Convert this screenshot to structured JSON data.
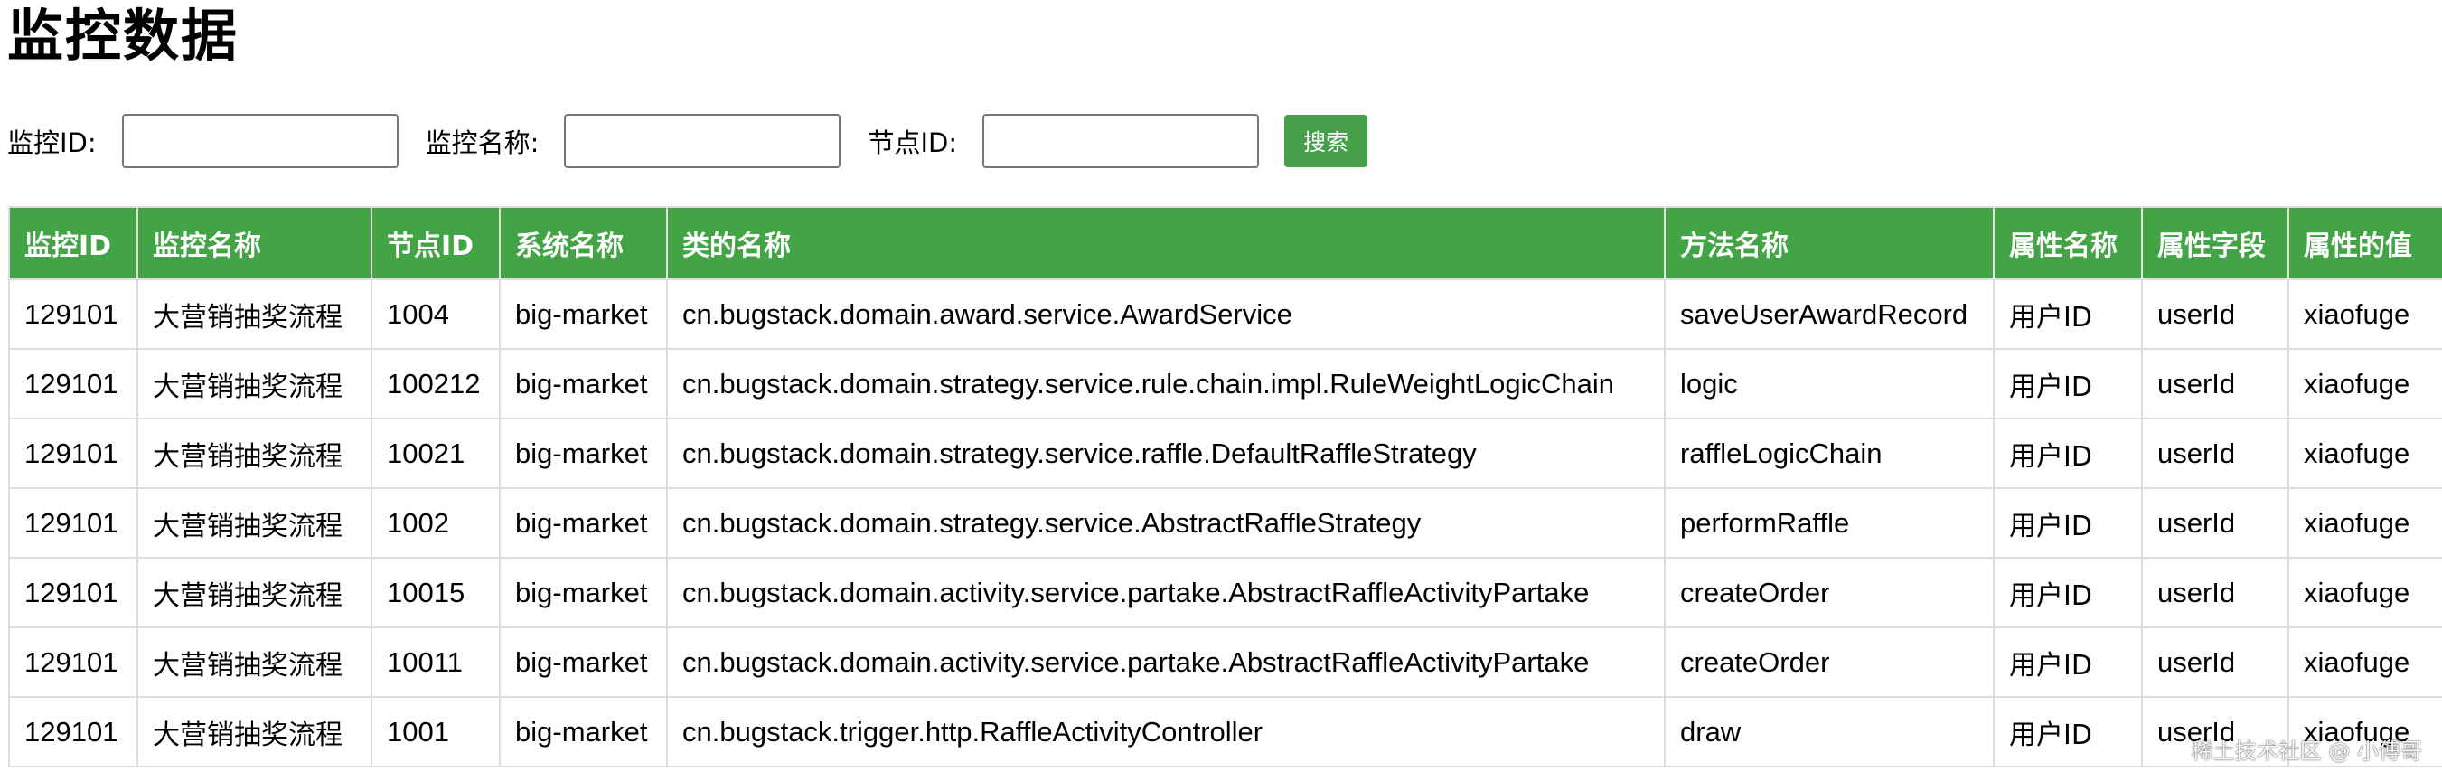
{
  "page": {
    "title": "监控数据"
  },
  "search": {
    "monitor_id_label": "监控ID:",
    "monitor_name_label": "监控名称:",
    "node_id_label": "节点ID:",
    "monitor_id_value": "",
    "monitor_name_value": "",
    "node_id_value": "",
    "button_label": "搜索"
  },
  "table": {
    "headers": [
      "监控ID",
      "监控名称",
      "节点ID",
      "系统名称",
      "类的名称",
      "方法名称",
      "属性名称",
      "属性字段",
      "属性的值"
    ],
    "rows": [
      [
        "129101",
        "大营销抽奖流程",
        "1004",
        "big-market",
        "cn.bugstack.domain.award.service.AwardService",
        "saveUserAwardRecord",
        "用户ID",
        "userId",
        "xiaofuge"
      ],
      [
        "129101",
        "大营销抽奖流程",
        "100212",
        "big-market",
        "cn.bugstack.domain.strategy.service.rule.chain.impl.RuleWeightLogicChain",
        "logic",
        "用户ID",
        "userId",
        "xiaofuge"
      ],
      [
        "129101",
        "大营销抽奖流程",
        "10021",
        "big-market",
        "cn.bugstack.domain.strategy.service.raffle.DefaultRaffleStrategy",
        "raffleLogicChain",
        "用户ID",
        "userId",
        "xiaofuge"
      ],
      [
        "129101",
        "大营销抽奖流程",
        "1002",
        "big-market",
        "cn.bugstack.domain.strategy.service.AbstractRaffleStrategy",
        "performRaffle",
        "用户ID",
        "userId",
        "xiaofuge"
      ],
      [
        "129101",
        "大营销抽奖流程",
        "10015",
        "big-market",
        "cn.bugstack.domain.activity.service.partake.AbstractRaffleActivityPartake",
        "createOrder",
        "用户ID",
        "userId",
        "xiaofuge"
      ],
      [
        "129101",
        "大营销抽奖流程",
        "10011",
        "big-market",
        "cn.bugstack.domain.activity.service.partake.AbstractRaffleActivityPartake",
        "createOrder",
        "用户ID",
        "userId",
        "xiaofuge"
      ],
      [
        "129101",
        "大营销抽奖流程",
        "1001",
        "big-market",
        "cn.bugstack.trigger.http.RaffleActivityController",
        "draw",
        "用户ID",
        "userId",
        "xiaofuge"
      ]
    ]
  },
  "watermark": {
    "text": "稀土技术社区 @ 小傅哥"
  },
  "colors": {
    "header_green": "#43a446",
    "button_green": "#45a049",
    "border_gray": "#dddddd"
  }
}
